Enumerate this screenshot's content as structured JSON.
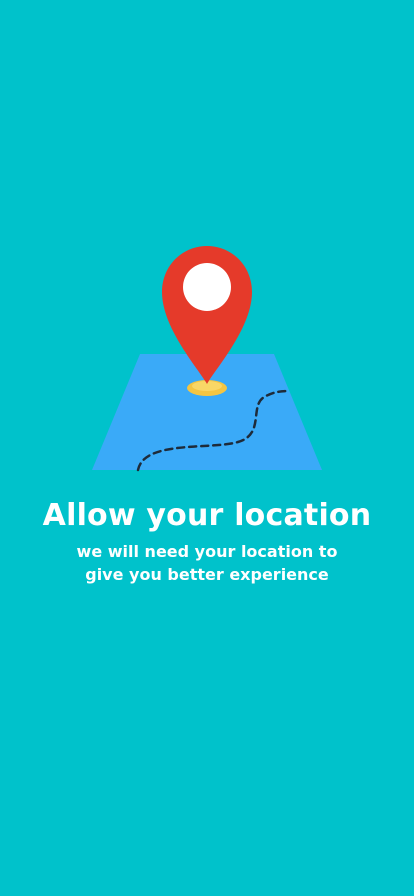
{
  "onboarding": {
    "title": "Allow your location",
    "subtitle": "we will need your location to give you better experience"
  },
  "illustration": {
    "icon": "location-pin-on-map-icon",
    "colors": {
      "background": "#00C2CB",
      "map": "#3AAAF8",
      "pin": "#E53A2A",
      "pin_center": "#FFFFFF",
      "pin_base": "#F4C542",
      "route": "#1E2B3A"
    }
  }
}
